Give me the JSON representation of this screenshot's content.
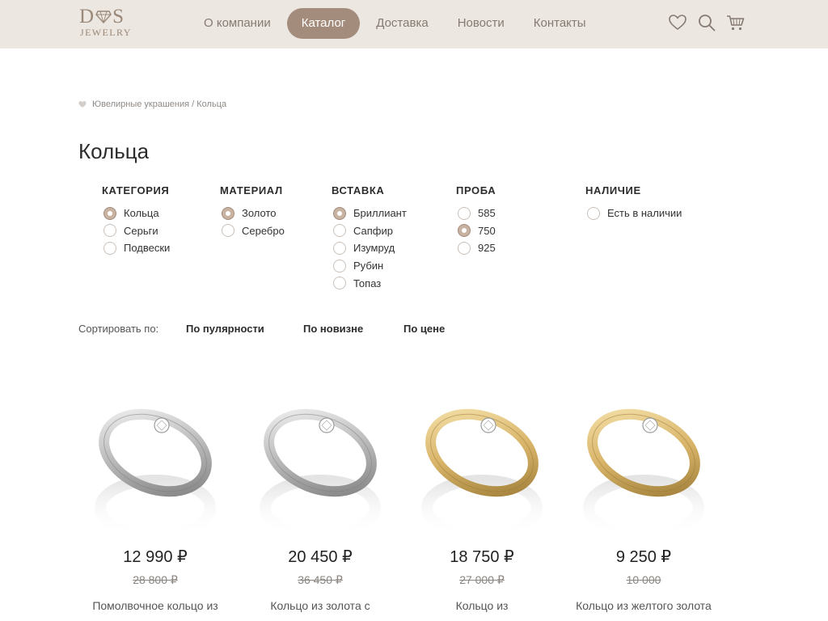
{
  "brand": {
    "logo_top": "D S",
    "logo_bottom": "JEWELRY"
  },
  "nav": {
    "items": [
      {
        "label": "О компании",
        "active": false
      },
      {
        "label": "Каталог",
        "active": true
      },
      {
        "label": "Доставка",
        "active": false
      },
      {
        "label": "Новости",
        "active": false
      },
      {
        "label": "Контакты",
        "active": false
      }
    ],
    "icons": [
      "heart-icon",
      "search-icon",
      "cart-icon"
    ]
  },
  "breadcrumb": {
    "root": "Ювелирные украшения",
    "separator": " / ",
    "current": "Кольца"
  },
  "page_title": "Кольца",
  "filters": [
    {
      "title": "КАТЕГОРИЯ",
      "options": [
        {
          "label": "Кольца",
          "checked": true
        },
        {
          "label": "Серьги",
          "checked": false
        },
        {
          "label": "Подвески",
          "checked": false
        }
      ]
    },
    {
      "title": "МАТЕРИАЛ",
      "options": [
        {
          "label": "Золото",
          "checked": true
        },
        {
          "label": "Серебро",
          "checked": false
        }
      ]
    },
    {
      "title": "ВСТАВКА",
      "options": [
        {
          "label": "Бриллиант",
          "checked": true
        },
        {
          "label": "Сапфир",
          "checked": false
        },
        {
          "label": "Изумруд",
          "checked": false
        },
        {
          "label": "Рубин",
          "checked": false
        },
        {
          "label": "Топаз",
          "checked": false
        }
      ]
    },
    {
      "title": "ПРОБА",
      "options": [
        {
          "label": "585",
          "checked": false
        },
        {
          "label": "750",
          "checked": true
        },
        {
          "label": "925",
          "checked": false
        }
      ]
    },
    {
      "title": "НАЛИЧИЕ",
      "options": [
        {
          "label": "Есть в наличии",
          "checked": false
        }
      ]
    }
  ],
  "sort": {
    "label": "Сортировать по:",
    "options": [
      "По пулярности",
      "По новизне",
      "По цене"
    ]
  },
  "products": [
    {
      "price": "12 990 ₽",
      "old_price": "28 800 ₽",
      "name": "Помолвочное кольцо из",
      "metal": "silver"
    },
    {
      "price": "20 450 ₽",
      "old_price": "36 450 ₽",
      "name": "Кольцо из золота с",
      "metal": "silver"
    },
    {
      "price": "18 750 ₽",
      "old_price": "27 000 ₽",
      "name": "Кольцо из",
      "metal": "gold"
    },
    {
      "price": "9 250 ₽",
      "old_price": "10 000",
      "name": "Кольцо из желтого золота",
      "metal": "gold"
    }
  ],
  "colors": {
    "accent": "#a48c7c",
    "header_bg": "#ede7e2",
    "text": "#2c2c2c"
  }
}
